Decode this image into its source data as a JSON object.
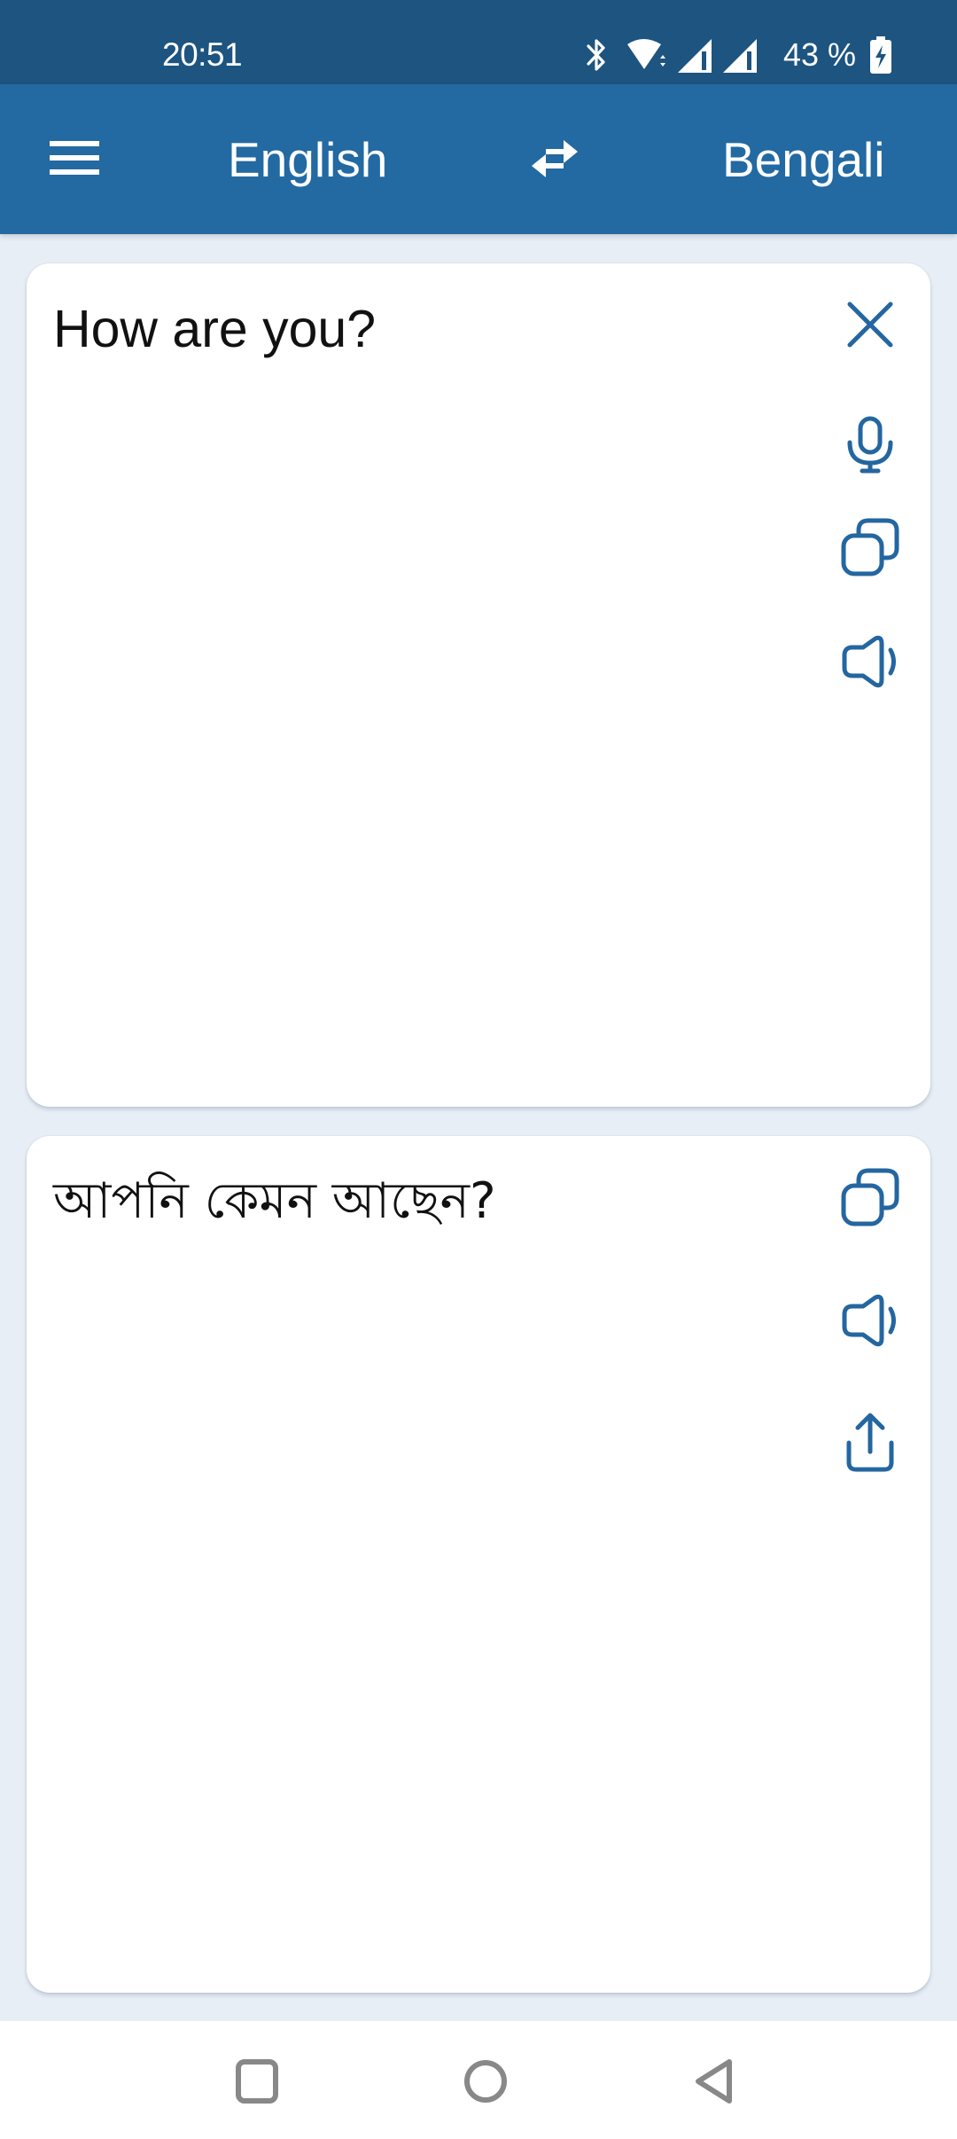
{
  "status_bar": {
    "time": "20:51",
    "battery_percent": "43 %",
    "icons": [
      "bluetooth-icon",
      "wifi-icon",
      "signal-icon",
      "signal-icon",
      "battery-charging-icon"
    ]
  },
  "toolbar": {
    "menu_icon": "hamburger-menu-icon",
    "source_language": "English",
    "swap_icon": "swap-languages-icon",
    "target_language": "Bengali"
  },
  "source_card": {
    "text": "How are you?",
    "actions": [
      "close-icon",
      "microphone-icon",
      "copy-icon",
      "speaker-icon"
    ]
  },
  "target_card": {
    "text": "আপনি কেমন আছেন?",
    "actions": [
      "copy-icon",
      "speaker-icon",
      "share-icon"
    ]
  },
  "nav_bar": {
    "buttons": [
      "recents-square-icon",
      "home-circle-icon",
      "back-triangle-icon"
    ]
  },
  "colors": {
    "status_bar": "#1d5480",
    "toolbar": "#2369a2",
    "background": "#e8eef6",
    "icon_accent": "#2466a0",
    "nav_icon": "#888888"
  }
}
